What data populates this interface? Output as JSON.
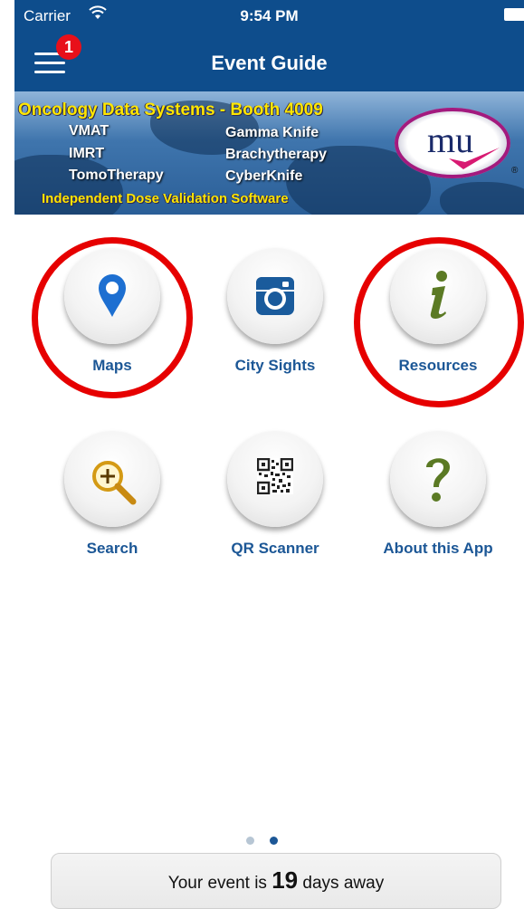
{
  "status_bar": {
    "carrier": "Carrier",
    "time": "9:54 PM"
  },
  "nav": {
    "title": "Event Guide",
    "badge_count": "1"
  },
  "banner": {
    "headline": "Oncology Data Systems - Booth 4009",
    "left_items": [
      "VMAT",
      "IMRT",
      "TomoTherapy"
    ],
    "right_items": [
      "Gamma Knife",
      "Brachytherapy",
      "CyberKnife"
    ],
    "tagline": "Independent Dose Validation Software",
    "logo_text": "mu",
    "reg_mark": "®"
  },
  "grid": {
    "items": [
      {
        "label": "Maps",
        "icon": "map-pin-icon"
      },
      {
        "label": "City Sights",
        "icon": "camera-icon"
      },
      {
        "label": "Resources",
        "icon": "info-icon"
      },
      {
        "label": "Search",
        "icon": "magnifier-plus-icon"
      },
      {
        "label": "QR Scanner",
        "icon": "qr-code-icon"
      },
      {
        "label": "About this App",
        "icon": "question-icon"
      }
    ]
  },
  "pager": {
    "count": 2,
    "active": 2
  },
  "countdown": {
    "prefix": "Your event is",
    "days": "19",
    "suffix": "days away"
  },
  "colors": {
    "nav_blue": "#0e4d8c",
    "label_blue": "#1c5796",
    "highlight_red": "#e60000",
    "badge_red": "#e8101a"
  }
}
